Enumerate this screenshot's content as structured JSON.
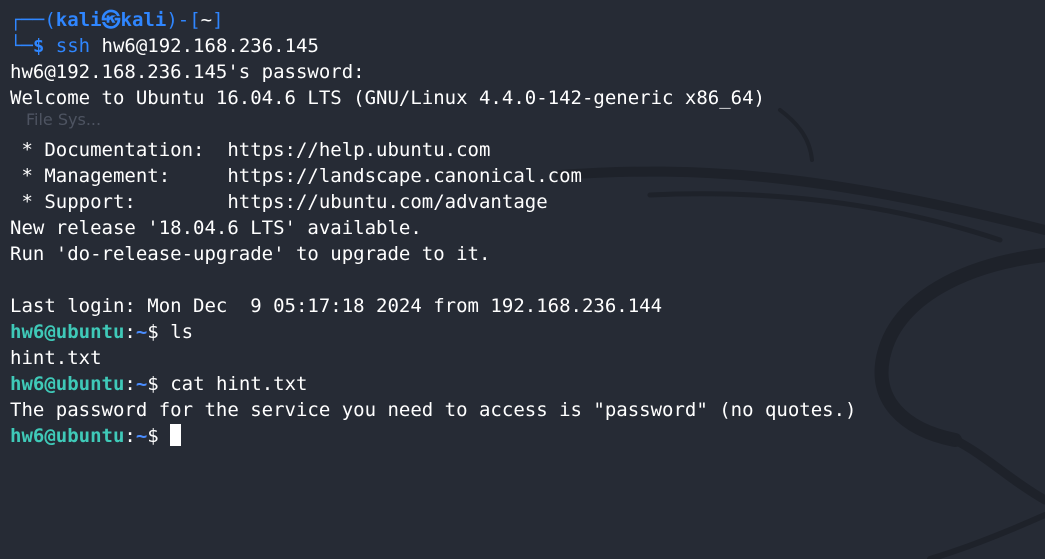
{
  "prompt_top": {
    "box_open": "┌──(",
    "user": "kali",
    "at_symbol": "㉿",
    "host": "kali",
    "sep": ")-[",
    "dir": "~",
    "close": "]"
  },
  "prompt_bottom": {
    "box": "└─",
    "dollar": "$",
    "cmd_name": " ssh",
    "cmd_args": " hw6@192.168.236.145"
  },
  "output": {
    "password_prompt": "hw6@192.168.236.145's password:",
    "welcome": "Welcome to Ubuntu 16.04.6 LTS (GNU/Linux 4.4.0-142-generic x86_64)",
    "doc": " * Documentation:  https://help.ubuntu.com",
    "mgmt": " * Management:     https://landscape.canonical.com",
    "support": " * Support:        https://ubuntu.com/advantage",
    "new_release": "New release '18.04.6 LTS' available.",
    "run_upgrade": "Run 'do-release-upgrade' to upgrade to it.",
    "last_login": "Last login: Mon Dec  9 05:17:18 2024 from 192.168.236.144",
    "ls_output": "hint.txt",
    "cat_output": "The password for the service you need to access is \"password\" (no quotes.)"
  },
  "remote_prompt": {
    "userhost": "hw6@ubuntu",
    "colon": ":",
    "path": "~",
    "dollar": "$ "
  },
  "commands": {
    "ls": "ls",
    "cat": "cat hint.txt"
  },
  "background_label": "File Sys...",
  "colors": {
    "background": "#262b35",
    "prompt_blue": "#2f86ff",
    "remote_user": "#3fc9b8",
    "text": "#ffffff"
  }
}
